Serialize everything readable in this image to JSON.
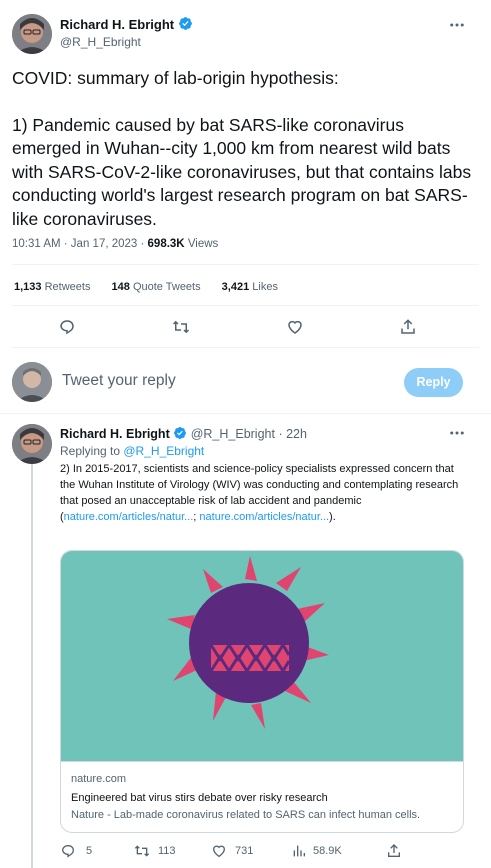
{
  "main_tweet": {
    "author_name": "Richard H. Ebright",
    "author_handle": "@R_H_Ebright",
    "text_line1": "COVID: summary of lab-origin hypothesis:",
    "text_body": "1) Pandemic caused by bat SARS-like coronavirus emerged in Wuhan--city 1,000 km from nearest wild bats with SARS-CoV-2-like coronaviruses, but that contains labs conducting world's largest research program on bat SARS-like coronaviruses.",
    "time": "10:31 AM · Jan 17, 2023 · ",
    "views_count": "698.3K",
    "views_label": " Views",
    "stats": {
      "retweets_count": "1,133",
      "retweets_label": "Retweets",
      "quotes_count": "148",
      "quotes_label": "Quote Tweets",
      "likes_count": "3,421",
      "likes_label": "Likes"
    },
    "more_icon": "more-horizontal-icon"
  },
  "reply_box": {
    "placeholder": "Tweet your reply",
    "button_label": "Reply"
  },
  "reply_tweet": {
    "author_name": "Richard H. Ebright",
    "author_handle": "@R_H_Ebright",
    "time_sep": " · ",
    "time": "22h",
    "replying_to_label": "Replying to ",
    "replying_to_handle": "@R_H_Ebright",
    "text_before_link": "2) In 2015-2017, scientists and science-policy specialists expressed concern that the Wuhan Institute of Virology (WIV) was conducting and contemplating research that posed an unacceptable risk of lab accident and pandemic (",
    "link1": "nature.com/articles/natur...",
    "text_between": ";",
    "link2": "nature.com/articles/natur...",
    "text_after": ").",
    "card": {
      "domain": "nature.com",
      "title": "Engineered bat virus stirs debate over risky research",
      "description": "Nature - Lab-made coronavirus related to SARS can infect human cells."
    },
    "actions": {
      "replies": "5",
      "retweets": "113",
      "likes": "731",
      "views": "58.9K"
    }
  },
  "colors": {
    "accent": "#1d9bf0",
    "reply_button_disabled": "#8ecdf8",
    "card_bg": "#6fc3b9",
    "virus_body": "#5b2a7f",
    "virus_spikes": "#e0456f"
  }
}
